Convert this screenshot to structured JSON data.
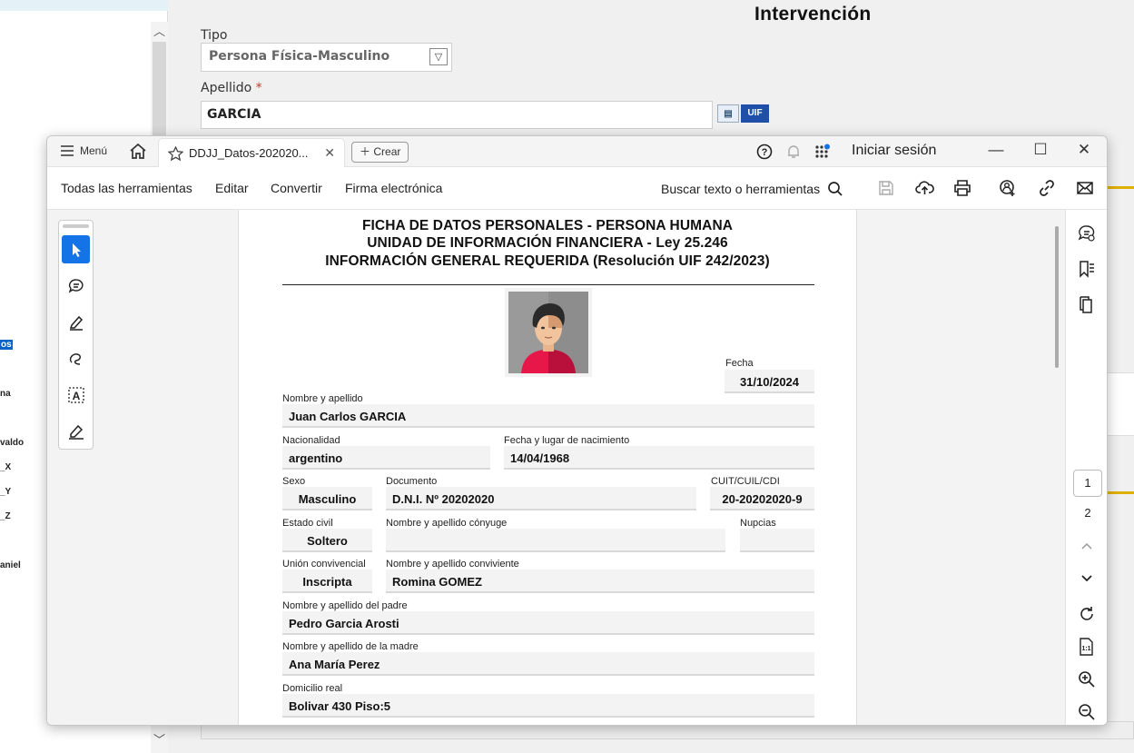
{
  "background_app": {
    "title": "Intervención",
    "tipo_label": "Tipo",
    "tipo_value": "Persona Física-Masculino",
    "apellido_label": "Apellido",
    "required_mark": "*",
    "apellido_value": "GARCIA",
    "uif_button": "UIF",
    "sidebar_items": [
      "os",
      "na",
      "valdo",
      "_X",
      "_Y",
      "_Z",
      "aniel"
    ]
  },
  "viewer": {
    "menu_label": "Menú",
    "tab_title": "DDJJ_Datos-202020...",
    "create_label": "Crear",
    "signin_label": "Iniciar sesión",
    "toolbar": {
      "all_tools": "Todas las herramientas",
      "edit": "Editar",
      "convert": "Convertir",
      "esign": "Firma electrónica",
      "search": "Buscar texto o herramientas"
    },
    "pages": {
      "current": "1",
      "next": "2"
    }
  },
  "document": {
    "heading1": "FICHA DE DATOS PERSONALES - PERSONA HUMANA",
    "heading2": "UNIDAD DE INFORMACIÓN FINANCIERA - Ley 25.246",
    "heading3": "INFORMACIÓN GENERAL REQUERIDA (Resolución UIF 242/2023)",
    "fecha_label": "Fecha",
    "fecha_value": "31/10/2024",
    "nombre_label": "Nombre y apellido",
    "nombre_value": "Juan Carlos GARCIA",
    "nacionalidad_label": "Nacionalidad",
    "nacionalidad_value": "argentino",
    "nacimiento_label": "Fecha y lugar de nacimiento",
    "nacimiento_value": "14/04/1968",
    "sexo_label": "Sexo",
    "sexo_value": "Masculino",
    "documento_label": "Documento",
    "documento_value": "D.N.I. Nº 20202020",
    "cuit_label": "CUIT/CUIL/CDI",
    "cuit_value": "20-20202020-9",
    "estado_label": "Estado civil",
    "estado_value": "Soltero",
    "conyuge_label": "Nombre y apellido cónyuge",
    "conyuge_value": "",
    "nupcias_label": "Nupcias",
    "nupcias_value": "",
    "union_label": "Unión convivencial",
    "union_value": "Inscripta",
    "conviviente_label": "Nombre y apellido conviviente",
    "conviviente_value": "Romina GOMEZ",
    "padre_label": "Nombre y apellido del padre",
    "padre_value": "Pedro Garcia Arosti",
    "madre_label": "Nombre y apellido de la madre",
    "madre_value": "Ana María Perez",
    "domicilio_label": "Domicilio real",
    "domicilio_value": "Bolivar 430 Piso:5"
  },
  "icons": [
    "hamburger-icon",
    "home-icon",
    "star-icon",
    "close-icon",
    "plus-icon",
    "help-icon",
    "bell-icon",
    "apps-icon",
    "minimize-icon",
    "maximize-icon",
    "search-icon",
    "save-icon",
    "upload-icon",
    "print-icon",
    "share-icon",
    "link-icon",
    "mail-icon",
    "cursor-icon",
    "comment-icon",
    "highlight-icon",
    "draw-icon",
    "text-select-icon",
    "sign-icon",
    "bookmark-icon",
    "pages-icon",
    "rotate-icon",
    "page-fit-icon",
    "zoom-in-icon",
    "zoom-out-icon",
    "chevron-up-icon",
    "chevron-down-icon"
  ]
}
